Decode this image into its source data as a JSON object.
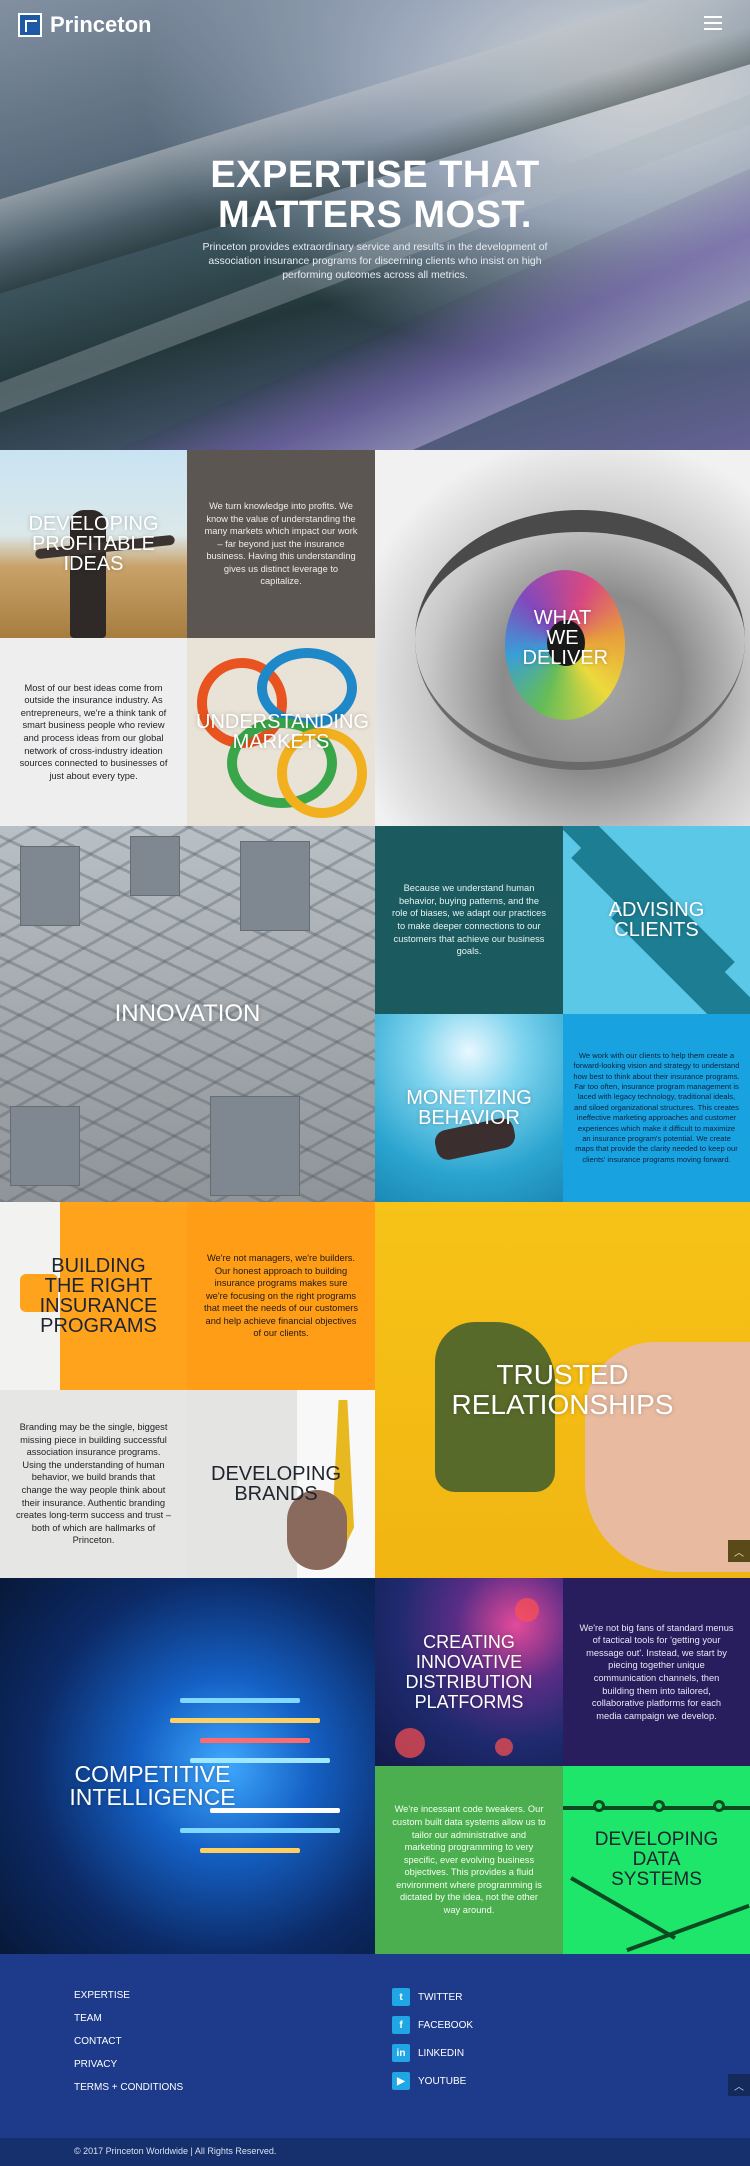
{
  "brand": {
    "name": "Princeton"
  },
  "hero": {
    "title": "EXPERTISE THAT MATTERS MOST.",
    "subtitle": "Princeton provides extraordinary service and results in the development of association insurance programs for discerning clients who insist on high performing outcomes across all metrics."
  },
  "tiles": {
    "developing_ideas": "DEVELOPING PROFITABLE IDEAS",
    "knowledge_text": "We turn knowledge into profits. We know the value of understanding the many markets which impact our work – far beyond just the insurance business. Having this understanding gives us distinct leverage to capitalize.",
    "what_we_deliver": "WHAT WE DELIVER",
    "ideas_text": "Most of our best ideas come from outside the insurance industry. As entrepreneurs, we're a think tank of smart business people who review and process ideas from our global network of cross-industry ideation sources connected to businesses of just about every type.",
    "understanding_markets": "UNDERSTANDING MARKETS",
    "innovation": "INNOVATION",
    "behavior_text": "Because we understand human behavior, buying patterns, and the role of biases, we adapt our practices to make deeper connections to our customers that achieve our business goals.",
    "advising_clients": "ADVISING CLIENTS",
    "monetizing_behavior": "MONETIZING BEHAVIOR",
    "clients_text": "We work with our clients to help them create a forward-looking vision and strategy to understand how best to think about their insurance programs. Far too often, insurance program management is laced with legacy technology, traditional ideals, and siloed organizational structures. This creates ineffective marketing approaches and customer experiences which make it difficult to maximize an insurance program's potential. We create maps that provide the clarity needed to keep our clients' insurance programs moving forward.",
    "building_programs": "BUILDING THE RIGHT INSURANCE PROGRAMS",
    "builders_text": "We're not managers, we're builders. Our honest approach to building insurance programs makes sure we're focusing on the right programs that meet the needs of our customers and help achieve financial objectives of our clients.",
    "trusted_relationships": "TRUSTED RELATIONSHIPS",
    "branding_text": "Branding may be the single, biggest missing piece in building successful association insurance programs. Using the understanding of human behavior, we build brands that change the way people think about their insurance. Authentic branding creates long-term success and trust – both of which are hallmarks of Princeton.",
    "developing_brands": "DEVELOPING BRANDS",
    "competitive_intelligence": "COMPETITIVE INTELLIGENCE",
    "creating_platforms": "CREATING INNOVATIVE DISTRIBUTION PLATFORMS",
    "menus_text": "We're not big fans of standard menus of tactical tools for 'getting your message out'. Instead, we start by piecing together unique communication channels, then building them into tailored, collaborative platforms for each media campaign we develop.",
    "code_text": "We're incessant code tweakers. Our custom built data systems allow us to tailor our administrative and marketing programming to very specific, ever evolving business objectives. This provides a fluid environment where programming is dictated by the idea, not the other way around.",
    "developing_data": "DEVELOPING DATA SYSTEMS"
  },
  "footer": {
    "links": [
      "EXPERTISE",
      "TEAM",
      "CONTACT",
      "PRIVACY",
      "TERMS + CONDITIONS"
    ],
    "social": [
      {
        "label": "TWITTER",
        "icon": "twitter-icon",
        "glyph": "t"
      },
      {
        "label": "FACEBOOK",
        "icon": "facebook-icon",
        "glyph": "f"
      },
      {
        "label": "LINKEDIN",
        "icon": "linkedin-icon",
        "glyph": "in"
      },
      {
        "label": "YOUTUBE",
        "icon": "youtube-icon",
        "glyph": "▶"
      }
    ],
    "copyright": "© 2017 Princeton Worldwide | All Rights Reserved."
  },
  "colors": {
    "footer_bg": "#1d3b8a",
    "social_icon_bg": "#20a6e4",
    "brand_blue": "#1d5aa6"
  }
}
